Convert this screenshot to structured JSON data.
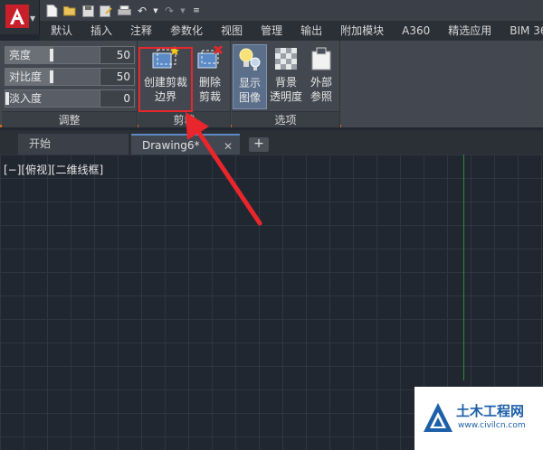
{
  "tabs": [
    {
      "label": "默认"
    },
    {
      "label": "插入"
    },
    {
      "label": "注释"
    },
    {
      "label": "参数化"
    },
    {
      "label": "视图"
    },
    {
      "label": "管理"
    },
    {
      "label": "输出"
    },
    {
      "label": "附加模块"
    },
    {
      "label": "A360"
    },
    {
      "label": "精选应用"
    },
    {
      "label": "BIM 36"
    }
  ],
  "adjust": {
    "title": "调整",
    "rows": [
      {
        "label": "亮度",
        "value": "50",
        "level": 0.5
      },
      {
        "label": "对比度",
        "value": "50",
        "level": 0.5
      },
      {
        "label": "淡入度",
        "value": "0",
        "level": 0
      }
    ]
  },
  "clip": {
    "title": "剪裁",
    "create_line1": "创建剪裁",
    "create_line2": "边界",
    "delete_line1": "删除",
    "delete_line2": "剪裁"
  },
  "options": {
    "title": "选项",
    "show_line1": "显示",
    "show_line2": "图像",
    "bg_line1": "背景",
    "bg_line2": "透明度",
    "ext_line1": "外部",
    "ext_line2": "参照"
  },
  "file_tabs": {
    "start": "开始",
    "drawing": "Drawing6*",
    "close": "✕",
    "add": "+"
  },
  "canvas": {
    "view_label": "[−][俯视][二维线框]"
  },
  "watermark": {
    "title": "土木工程网",
    "url": "www.civilcn.com"
  },
  "colors": {
    "accent_orange": "#d9661a",
    "highlight_red": "#e8262b",
    "axis_green": "#2f8a3a"
  }
}
